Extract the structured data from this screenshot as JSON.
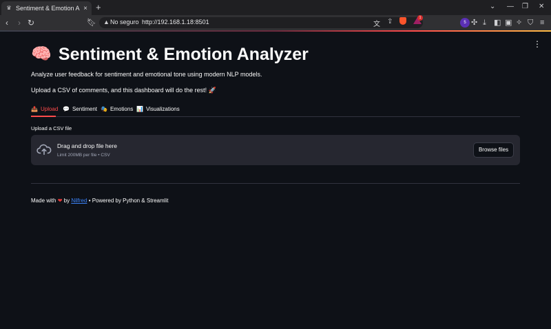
{
  "browser": {
    "tab_title": "Sentiment & Emotion Analyzer",
    "tab_favicon": "♛",
    "tab_close": "×",
    "new_tab": "+",
    "security_label": "No seguro",
    "url": "http://192.168.1.18:8501",
    "bat_badge": "1",
    "ext_badge": "5",
    "colors": {
      "accent": "#ff4b4b",
      "brave": "#fb542b"
    }
  },
  "app": {
    "title_emoji": "🧠",
    "title": "Sentiment & Emotion Analyzer",
    "description": "Analyze user feedback for sentiment and emotional tone using modern NLP models.",
    "instruction": "Upload a CSV of comments, and this dashboard will do the rest! 🚀",
    "tabs": [
      {
        "emoji": "📤",
        "label": "Upload",
        "active": true
      },
      {
        "emoji": "💬",
        "label": "Sentiment",
        "active": false
      },
      {
        "emoji": "🎭",
        "label": "Emotions",
        "active": false
      },
      {
        "emoji": "📊",
        "label": "Visualizations",
        "active": false
      }
    ],
    "uploader": {
      "label": "Upload a CSV file",
      "drop_text": "Drag and drop file here",
      "limit_text": "Limit 200MB per file • CSV",
      "browse_label": "Browse files"
    },
    "footer": {
      "made_with": "Made with",
      "heart": "❤",
      "by": "by",
      "author": "Nilfred",
      "powered": "• Powered by Python & Streamlit"
    }
  }
}
